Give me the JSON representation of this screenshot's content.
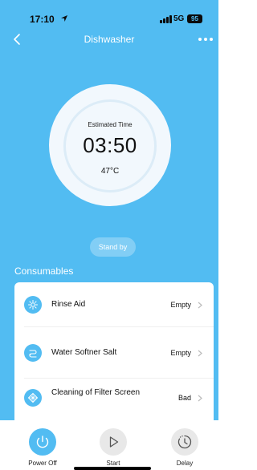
{
  "status_bar": {
    "time": "17:10",
    "network": "5G",
    "battery": "95"
  },
  "header": {
    "title": "Dishwasher"
  },
  "dial": {
    "label": "Estimated Time",
    "time": "03:50",
    "temperature": "47°C"
  },
  "state": {
    "status": "Stand by"
  },
  "consumables": {
    "title": "Consumables",
    "items": [
      {
        "label": "Rinse Aid",
        "value": "Empty",
        "icon": "sparkle-icon"
      },
      {
        "label": "Water Softner Salt",
        "value": "Empty",
        "icon": "salt-icon"
      },
      {
        "label": "Cleaning of Filter Screen",
        "value": "Bad",
        "icon": "filter-icon"
      }
    ]
  },
  "controls": {
    "power_label": "Power Off",
    "start_label": "Start",
    "delay_label": "Delay"
  },
  "colors": {
    "accent": "#52bcf2",
    "power_button": "#52bcf2",
    "inactive_button": "#e8e8e8"
  }
}
